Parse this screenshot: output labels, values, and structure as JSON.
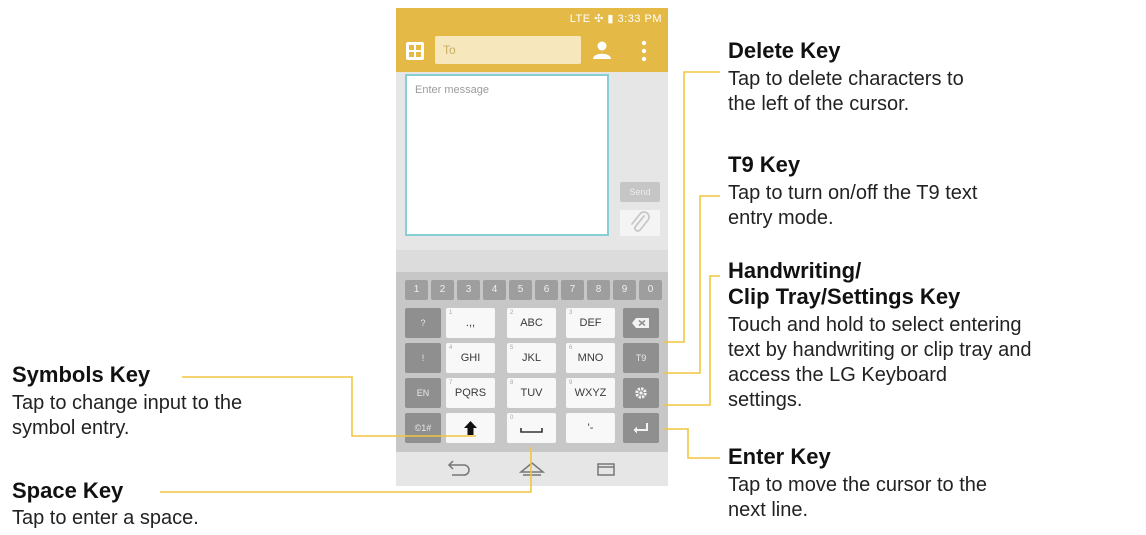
{
  "status_bar": {
    "text": "LTE ✣ ▮ 3:33 PM"
  },
  "app_bar": {
    "to_placeholder": "To"
  },
  "compose": {
    "message_placeholder": "Enter message",
    "send_label": "Send"
  },
  "keyboard": {
    "number_row": [
      "1",
      "2",
      "3",
      "4",
      "5",
      "6",
      "7",
      "8",
      "9",
      "0"
    ],
    "rows": [
      {
        "left": "?",
        "keys": [
          {
            "label": ".,,",
            "sub": "1"
          },
          {
            "label": "ABC",
            "sub": "2"
          },
          {
            "label": "DEF",
            "sub": "3"
          }
        ],
        "right_icon": "backspace-icon"
      },
      {
        "left": "!",
        "keys": [
          {
            "label": "GHI",
            "sub": "4"
          },
          {
            "label": "JKL",
            "sub": "5"
          },
          {
            "label": "MNO",
            "sub": "6"
          }
        ],
        "right": "T9"
      },
      {
        "left": "EN",
        "keys": [
          {
            "label": "PQRS",
            "sub": "7"
          },
          {
            "label": "TUV",
            "sub": "8"
          },
          {
            "label": "WXYZ",
            "sub": "9"
          }
        ],
        "right_icon": "gear-icon"
      },
      {
        "left": "©1#",
        "keys": [
          {
            "label": "",
            "icon": "shift-icon"
          },
          {
            "label": "",
            "sub": "0",
            "icon": "space-bar-icon"
          },
          {
            "label": "'-"
          }
        ],
        "right_icon": "enter-icon"
      }
    ]
  },
  "nav_icons": [
    "back-icon",
    "home-icon",
    "recent-apps-icon"
  ],
  "callouts": {
    "delete": {
      "title": "Delete Key",
      "lines": [
        "Tap to delete characters to",
        "the left of the cursor."
      ]
    },
    "t9": {
      "title": "T9 Key",
      "lines": [
        "Tap to turn on/off the T9 text",
        "entry mode."
      ]
    },
    "handwriting": {
      "title_lines": [
        "Handwriting/",
        "Clip Tray/Settings Key"
      ],
      "lines": [
        "Touch and hold to select entering",
        "text by handwriting or clip tray and",
        "access the LG Keyboard",
        "settings."
      ]
    },
    "enter": {
      "title": "Enter Key",
      "lines": [
        "Tap to move the cursor to the",
        "next line."
      ]
    },
    "symbols": {
      "title": "Symbols Key",
      "lines": [
        "Tap to change input to the",
        "symbol entry."
      ]
    },
    "space": {
      "title": "Space Key",
      "lines": [
        "Tap to enter a space."
      ]
    }
  },
  "colors": {
    "accent": "#e5b946",
    "callout_line": "#f2c640",
    "message_border": "#86d0d5"
  }
}
